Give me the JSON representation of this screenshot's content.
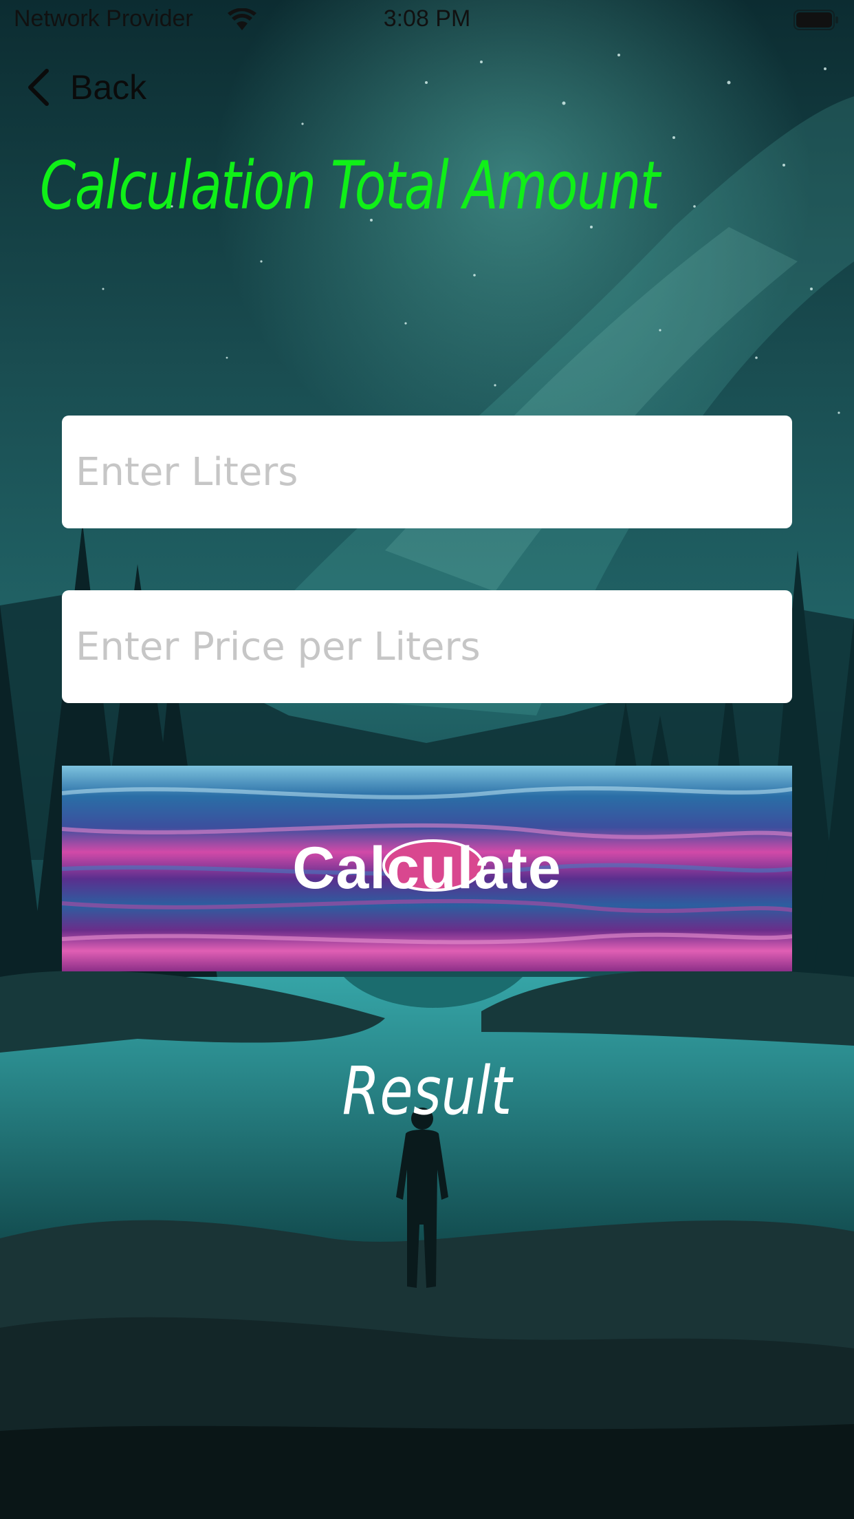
{
  "status_bar": {
    "carrier": "Network Provider",
    "time": "3:08 PM",
    "wifi_icon": "wifi-icon",
    "battery_icon": "battery-icon"
  },
  "nav": {
    "back_label": "Back",
    "back_icon": "chevron-left-icon"
  },
  "title": "Calculation Total Amount",
  "form": {
    "liters": {
      "value": "",
      "placeholder": "Enter Liters"
    },
    "price": {
      "value": "",
      "placeholder": "Enter Price per Liters"
    },
    "calculate_label": "Calculate"
  },
  "result": {
    "label": "Result"
  },
  "colors": {
    "title": "#10f018",
    "field_background": "#ffffff",
    "placeholder": "#c6c6c6",
    "result_text": "#ffffff"
  }
}
